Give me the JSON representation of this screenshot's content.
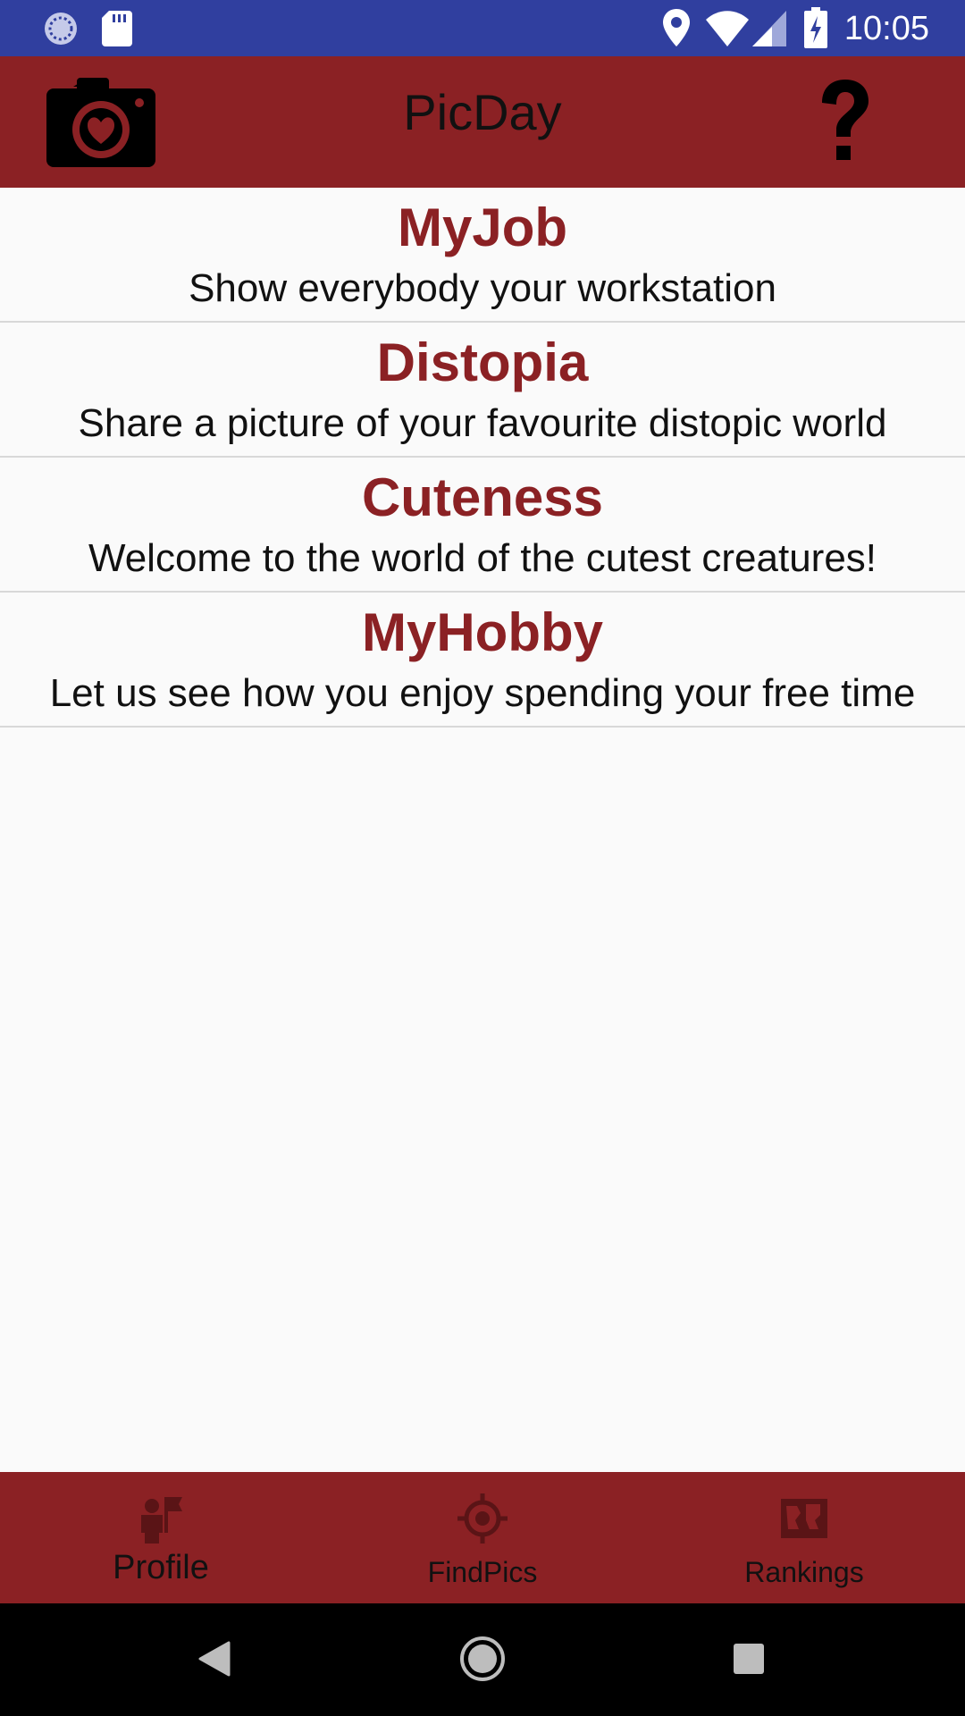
{
  "status_bar": {
    "time": "10:05",
    "icons": [
      "sync-icon",
      "sd-card-icon",
      "location-icon",
      "wifi-icon",
      "signal-icon",
      "battery-charging-icon"
    ]
  },
  "app_bar": {
    "title": "PicDay",
    "left_icon": "camera-heart-icon",
    "right_icon": "help-icon"
  },
  "challenges": [
    {
      "title": "MyJob",
      "description": "Show everybody your workstation"
    },
    {
      "title": "Distopia",
      "description": "Share a picture of your favourite distopic world"
    },
    {
      "title": "Cuteness",
      "description": "Welcome to the world of the cutest creatures!"
    },
    {
      "title": "MyHobby",
      "description": "Let us see how you enjoy spending your free time"
    }
  ],
  "bottom_nav": {
    "items": [
      {
        "label": "Profile",
        "icon": "profile-flag-icon",
        "active": true
      },
      {
        "label": "FindPics",
        "icon": "crosshair-icon",
        "active": false
      },
      {
        "label": "Rankings",
        "icon": "map-image-icon",
        "active": false
      }
    ]
  },
  "colors": {
    "status_bar": "#303f9f",
    "primary": "#8b2124",
    "background": "#fafafa"
  }
}
